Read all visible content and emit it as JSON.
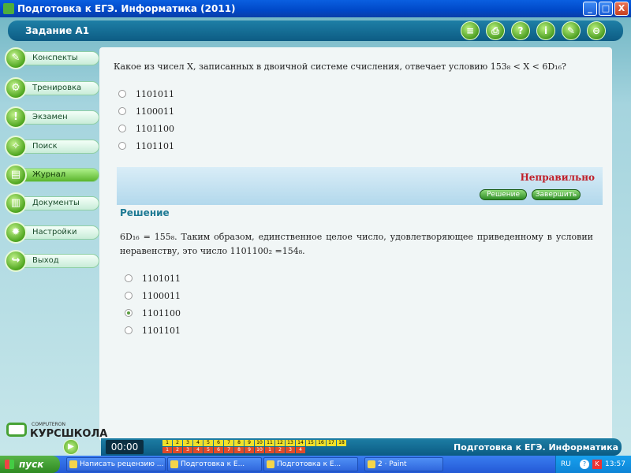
{
  "window": {
    "title": "Подготовка к ЕГЭ. Информатика (2011)",
    "min": "_",
    "max": "□",
    "close": "X"
  },
  "header": {
    "task_label": "Задание А1",
    "tool_icons": [
      "≡",
      "⎙",
      "?",
      "i",
      "✎",
      "⊖"
    ]
  },
  "sidebar": {
    "items": [
      {
        "label": "Конспекты",
        "icon": "✎"
      },
      {
        "label": "Тренировка",
        "icon": "⚙"
      },
      {
        "label": "Экзамен",
        "icon": "!"
      },
      {
        "label": "Поиск",
        "icon": "✧"
      },
      {
        "label": "Журнал",
        "icon": "▤"
      },
      {
        "label": "Документы",
        "icon": "▥"
      },
      {
        "label": "Настройки",
        "icon": "✹"
      },
      {
        "label": "Выход",
        "icon": "↪"
      }
    ]
  },
  "question": {
    "text": "Какое из чисел X, записанных в двоичной системе счисления, отвечает условию 153₈ < X < 6D₁₆?",
    "options": [
      "1101011",
      "1100011",
      "1101100",
      "1101101"
    ]
  },
  "feedback": {
    "verdict": "Неправильно",
    "solution_btn": "Решение",
    "finish_btn": "Завершить"
  },
  "solution": {
    "title": "Решение",
    "text": "6D₁₆ = 155₈. Таким образом, единственное целое число, удовлетворяющее приведенному в условии неравенству, это число 1101100₂ =154₈.",
    "options": [
      "1101011",
      "1100011",
      "1101100",
      "1101101"
    ],
    "checked_index": 2
  },
  "logo": {
    "small": "COMPUTERON",
    "big": "КУРСШКОЛА"
  },
  "footer": {
    "timer": "00:00",
    "title": "Подготовка к ЕГЭ. Информатика",
    "top_nums": [
      "1",
      "2",
      "3",
      "4",
      "5",
      "6",
      "7",
      "8",
      "9",
      "10",
      "11",
      "12",
      "13",
      "14",
      "15",
      "16",
      "17",
      "18"
    ],
    "bottom_nums": [
      "1",
      "2",
      "3",
      "4",
      "5",
      "6",
      "7",
      "8",
      "9",
      "10",
      "1",
      "2",
      "3",
      "4"
    ]
  },
  "taskbar": {
    "start": "пуск",
    "tasks": [
      "Написать рецензию ...",
      "Подготовка к Е...",
      "Подготовка к Е...",
      "2 · Paint"
    ],
    "lang": "RU",
    "time": "13:57"
  }
}
